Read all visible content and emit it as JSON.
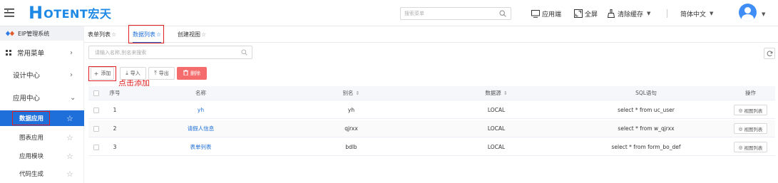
{
  "header": {
    "logo_mark": "H",
    "logo_text": "OTENT宏天",
    "search_placeholder": "搜索菜单",
    "app_label": "应用端",
    "fullscreen_label": "全屏",
    "clear_cache_label": "清除缓存",
    "language_label": "简体中文",
    "caret": "▼",
    "accent": "#1e88e5"
  },
  "sidebar": {
    "system_title": "EIP管理系统",
    "groups": [
      {
        "label": "常用菜单",
        "chevron": "›"
      },
      {
        "label": "设计中心",
        "chevron": "›"
      },
      {
        "label": "应用中心",
        "chevron": "⌄"
      }
    ],
    "items": [
      {
        "label": "数据应用",
        "icon": "star-icon"
      },
      {
        "label": "图表应用",
        "icon": "star-icon"
      },
      {
        "label": "应用模块",
        "icon": "star-icon"
      },
      {
        "label": "代码生成",
        "icon": "star-icon"
      }
    ],
    "star": "☆",
    "active_color": "#1e6fd9"
  },
  "tabs": [
    {
      "label": "表单列表"
    },
    {
      "label": "数据列表"
    },
    {
      "label": "创建视图"
    }
  ],
  "tab_star": "☆",
  "filter": {
    "placeholder": "请输入名称,别名来搜索"
  },
  "toolbar": {
    "add_label": "添加",
    "import_label": "导入",
    "export_label": "导出",
    "delete_label": "删除",
    "hint": "点击添加"
  },
  "table": {
    "headers": {
      "index": "序号",
      "name": "名称",
      "alias": "别名",
      "source": "数据源",
      "sql": "SQL语句",
      "action": "操作"
    },
    "sort_glyph": "⇕",
    "rows": [
      {
        "index": "1",
        "name": "yh",
        "alias": "yh",
        "source": "LOCAL",
        "sql": "select * from uc_user",
        "action": "视图列表"
      },
      {
        "index": "2",
        "name": "请假人信息",
        "alias": "qjrxx",
        "source": "LOCAL",
        "sql": "select * from w_qjrxx",
        "action": "视图列表"
      },
      {
        "index": "3",
        "name": "表单列表",
        "alias": "bdlb",
        "source": "LOCAL",
        "sql": "select * from form_bo_def",
        "action": "视图列表"
      }
    ]
  }
}
